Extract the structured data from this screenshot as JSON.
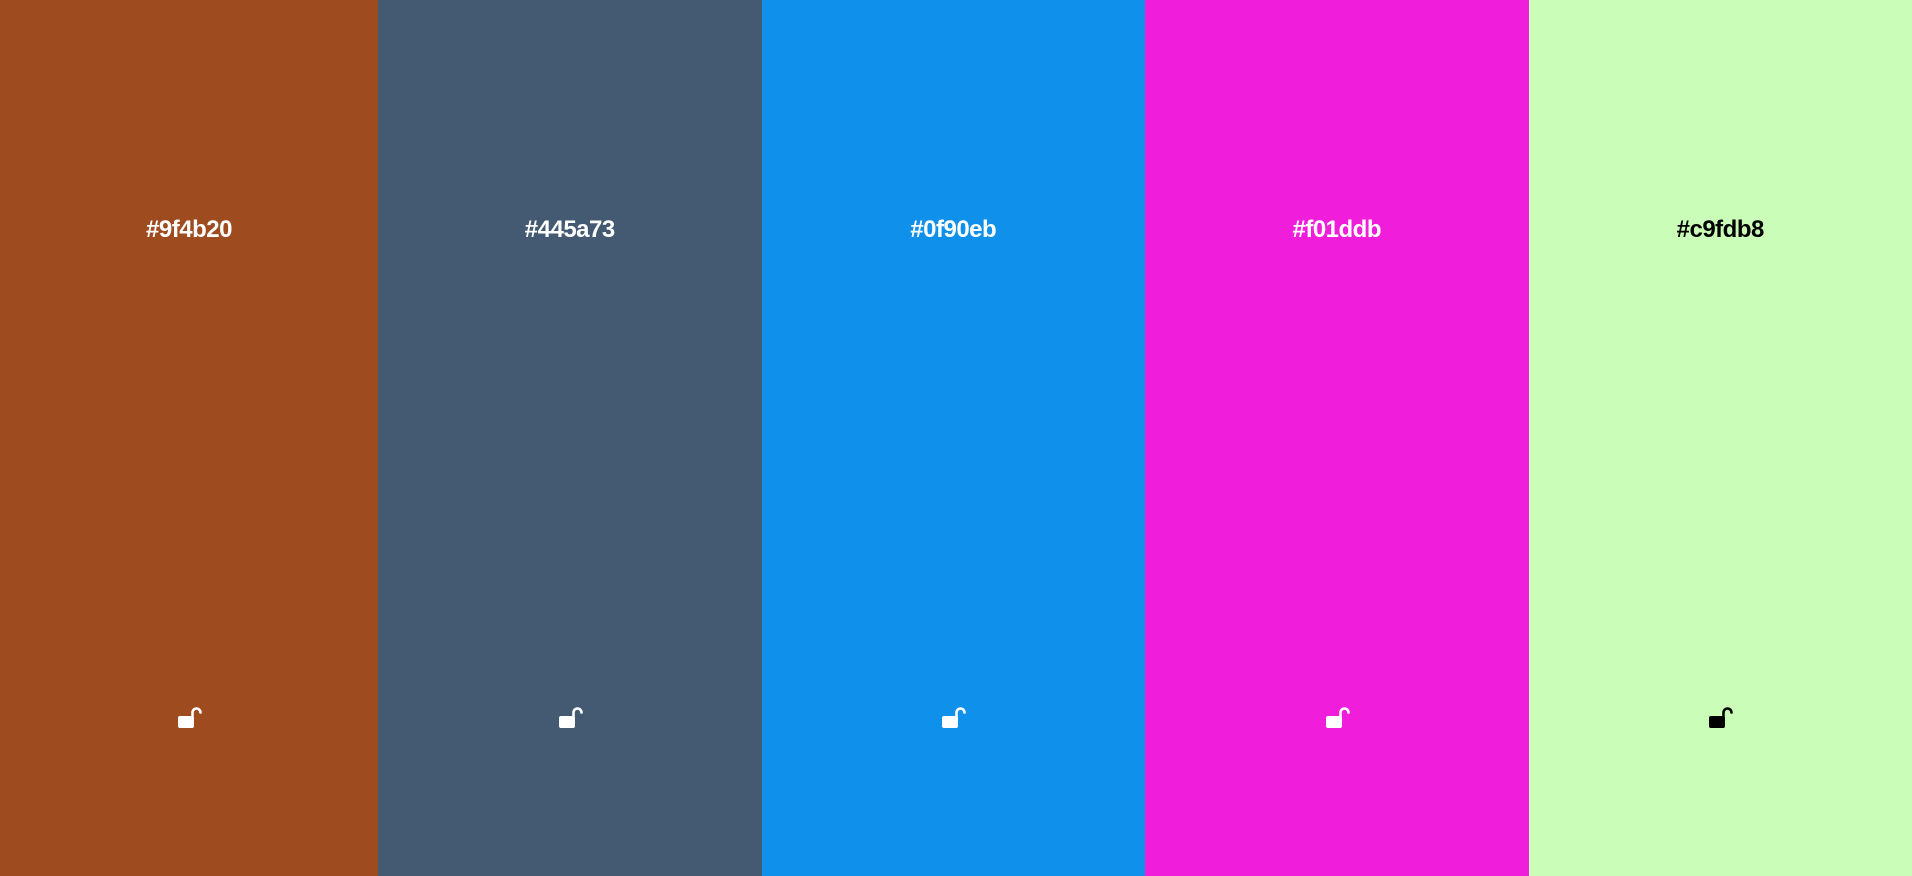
{
  "palette": {
    "colors": [
      {
        "hex": "#9f4b20",
        "text_color": "#ffffff",
        "locked": false,
        "lock_icon": "unlocked-padlock-icon"
      },
      {
        "hex": "#445a73",
        "text_color": "#ffffff",
        "locked": false,
        "lock_icon": "unlocked-padlock-icon"
      },
      {
        "hex": "#0f90eb",
        "text_color": "#ffffff",
        "locked": false,
        "lock_icon": "unlocked-padlock-icon"
      },
      {
        "hex": "#f01ddb",
        "text_color": "#ffffff",
        "locked": false,
        "lock_icon": "unlocked-padlock-icon"
      },
      {
        "hex": "#c9fdb8",
        "text_color": "#000000",
        "locked": false,
        "lock_icon": "unlocked-padlock-icon"
      }
    ]
  }
}
